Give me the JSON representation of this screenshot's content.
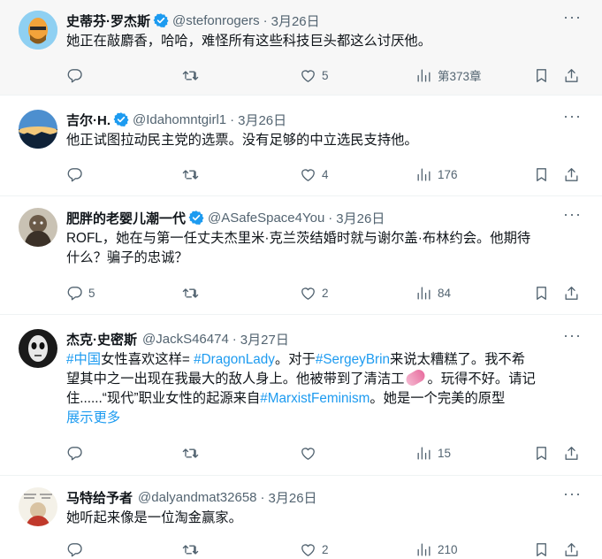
{
  "tweets": [
    {
      "name": "史蒂芬·罗杰斯",
      "handle": "@stefonrogers",
      "time": "3月26日",
      "text": "她正在敲麝香，哈哈，难怪所有这些科技巨头都这么讨厌他。",
      "replies": "",
      "retweets": "",
      "likes": "5",
      "views": "第373章"
    },
    {
      "name": "吉尔·H.",
      "handle": "@Idahomntgirl1",
      "time": "3月26日",
      "text": "他正试图拉动民主党的选票。没有足够的中立选民支持他。",
      "replies": "",
      "retweets": "",
      "likes": "4",
      "views": "176"
    },
    {
      "name": "肥胖的老婴儿潮一代",
      "handle": "@ASafeSpace4You",
      "time": "3月26日",
      "text_line1": "ROFL，她在与第一任丈夫杰里米·克兰茨结婚时就与谢尔盖·布林约会。他期待",
      "text_line2": "什么？骗子的忠诚？",
      "replies": "5",
      "retweets": "",
      "likes": "2",
      "views": "84"
    },
    {
      "name": "杰克·史密斯",
      "handle": "@JackS46474",
      "time": "3月27日",
      "tag_china": "#中国",
      "seg1": "女性喜欢这样= ",
      "tag_dragon": "#DragonLady",
      "seg2": "。对于",
      "tag_sergey": "#SergeyBrin",
      "seg3": "来说太糟糕了。我不希",
      "seg4": "望其中之一出现在我最大的敌人身上。他被带到了清洁工",
      "seg5": "。玩得不好。请记",
      "seg6": "住......“现代”职业女性的起源来自",
      "tag_marxist": "#MarxistFeminism",
      "seg7": "。她是一个完美的原型",
      "show_more": "展示更多",
      "replies": "",
      "retweets": "",
      "likes": "",
      "views": "15"
    },
    {
      "name": "马特给予者",
      "handle": "@dalyandmat32658",
      "time": "3月26日",
      "text": "她听起来像是一位淘金赢家。",
      "replies": "",
      "retweets": "",
      "likes": "2",
      "views": "210"
    }
  ],
  "separator": "·",
  "more_glyph": "···",
  "colors": {
    "accent": "#1d9bf0",
    "muted": "#536471",
    "text": "#0f1419",
    "verified": "#1d9bf0"
  }
}
